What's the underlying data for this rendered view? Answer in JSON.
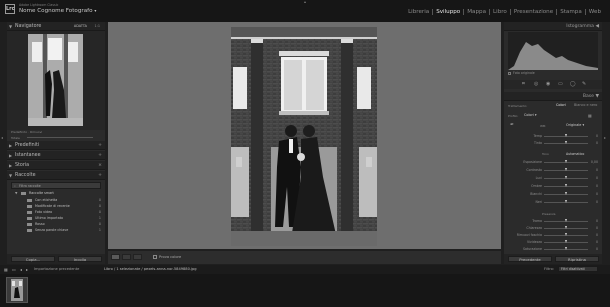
{
  "app": {
    "subtitle": "Adobe Lightroom Classic",
    "user": "Nome Cognome Fotografo",
    "logo": "Lrc"
  },
  "modules": [
    "Libreria",
    "Sviluppo",
    "Mappa",
    "Libro",
    "Presentazione",
    "Stampa",
    "Web"
  ],
  "active_module": "Sviluppo",
  "left_panel": {
    "navigator": {
      "title": "Navigatore",
      "zoom_options": [
        "ADATTA",
        "1:1"
      ]
    },
    "presets": {
      "title": "Predefiniti"
    },
    "snapshots": {
      "title": "Istantanee"
    },
    "history": {
      "title": "Storia"
    },
    "collections": {
      "title": "Raccolte",
      "filter_label": "Filtra raccolte",
      "set_label": "Raccolte smart",
      "items": [
        {
          "label": "Con etichetta",
          "count": "0"
        },
        {
          "label": "Modificate di recente",
          "count": "0"
        },
        {
          "label": "Foto video",
          "count": "0"
        },
        {
          "label": "Ultimo importato",
          "count": "1"
        },
        {
          "label": "Rosso",
          "count": "0"
        },
        {
          "label": "Senza parole chiave",
          "count": "1"
        }
      ]
    },
    "copy_button": "Copia...",
    "paste_button": "Incolla"
  },
  "right_panel": {
    "histogram": {
      "title": "Istogramma",
      "original_label": "Foto originale"
    },
    "basic": {
      "title": "Base",
      "treatment_label": "Trattamento:",
      "treatment_options": [
        "Colori",
        "Bianco e nero"
      ],
      "profile_label": "Profilo:",
      "profile_value": "Colori",
      "wb_label": "WB:",
      "wb_value": "Originale",
      "tone_label": "Tono",
      "tone_auto": "Automatico",
      "presence_label": "Presenza",
      "sliders_wb": [
        {
          "label": "Temp",
          "value": "0",
          "pos": 0.5
        },
        {
          "label": "Tinta",
          "value": "0",
          "pos": 0.5
        }
      ],
      "sliders_tone": [
        {
          "label": "Esposizione",
          "value": "0,00",
          "pos": 0.5
        },
        {
          "label": "Contrasto",
          "value": "0",
          "pos": 0.5
        },
        {
          "label": "Luci",
          "value": "0",
          "pos": 0.5
        },
        {
          "label": "Ombre",
          "value": "0",
          "pos": 0.5
        },
        {
          "label": "Bianchi",
          "value": "0",
          "pos": 0.5
        },
        {
          "label": "Neri",
          "value": "0",
          "pos": 0.5
        }
      ],
      "sliders_presence": [
        {
          "label": "Trama",
          "value": "0",
          "pos": 0.5
        },
        {
          "label": "Chiarezza",
          "value": "0",
          "pos": 0.5
        },
        {
          "label": "Rimuovi foschia",
          "value": "0",
          "pos": 0.5
        },
        {
          "label": "Vividezza",
          "value": "0",
          "pos": 0.5
        },
        {
          "label": "Saturazione",
          "value": "0",
          "pos": 0.5
        }
      ]
    },
    "previous_button": "Precedente",
    "reset_button": "Ripristina"
  },
  "toolbar": {
    "softproof_label": "Prova colore"
  },
  "filmbar": {
    "import_label": "Importazione precedente",
    "path_text": "Libro / 1 selezionate / pexels-anna-nor-5849880.jpg",
    "filter_label": "Filtro:",
    "filter_value": "Filtri disattivati"
  }
}
